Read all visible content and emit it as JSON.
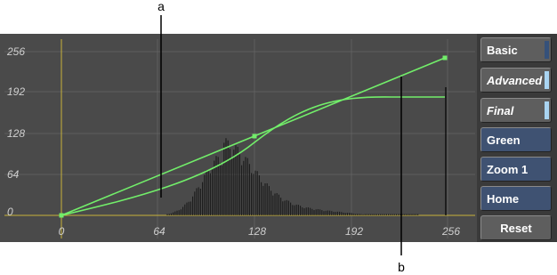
{
  "graph": {
    "y_ticks": [
      "256",
      "192",
      "128",
      "64",
      "0"
    ],
    "x_ticks": [
      "0",
      "64",
      "128",
      "192",
      "256"
    ],
    "colors": {
      "curve": "#72ee6a",
      "axis": "#c8b23a",
      "grid": "#5f5f5f",
      "histogram": "#1a1a1a",
      "panel": "#4a4a4a"
    }
  },
  "callouts": {
    "a": "a",
    "b": "b"
  },
  "buttons": {
    "basic": "Basic",
    "advanced": "Advanced",
    "final": "Final",
    "green": "Green",
    "zoom": "Zoom 1",
    "home": "Home",
    "reset": "Reset"
  }
}
